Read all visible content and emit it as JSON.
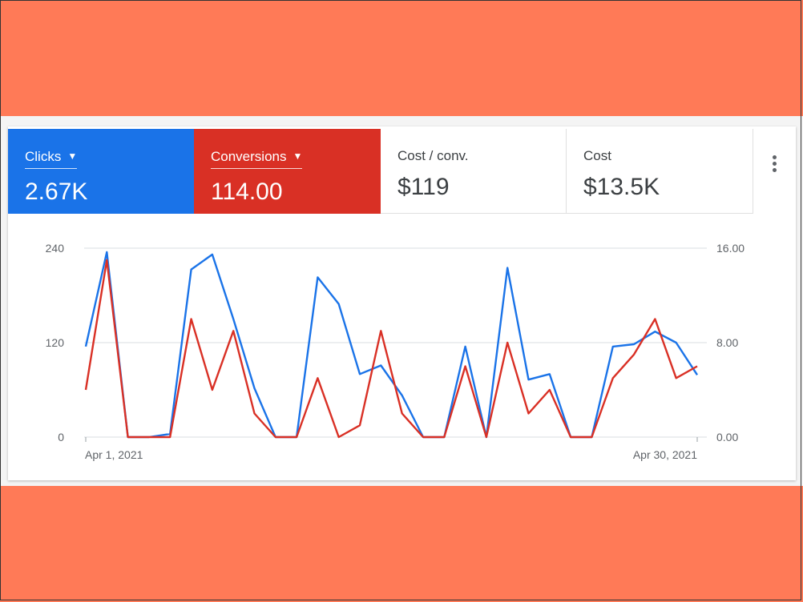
{
  "metrics": {
    "clicks": {
      "label": "Clicks",
      "value": "2.67K"
    },
    "conversions": {
      "label": "Conversions",
      "value": "114.00"
    },
    "cost_per_conv": {
      "label": "Cost / conv.",
      "value": "$119"
    },
    "cost": {
      "label": "Cost",
      "value": "$13.5K"
    }
  },
  "colors": {
    "clicks": "#1a73e8",
    "conversions": "#d93025",
    "background": "#ff7a57"
  },
  "icons": {
    "dropdown": "caret-down-icon",
    "more": "more-vert-icon"
  },
  "chart_data": {
    "type": "line",
    "x_start_label": "Apr 1, 2021",
    "x_end_label": "Apr 30, 2021",
    "x": [
      "Apr 1",
      "Apr 2",
      "Apr 3",
      "Apr 4",
      "Apr 5",
      "Apr 6",
      "Apr 7",
      "Apr 8",
      "Apr 9",
      "Apr 10",
      "Apr 11",
      "Apr 12",
      "Apr 13",
      "Apr 14",
      "Apr 15",
      "Apr 16",
      "Apr 17",
      "Apr 18",
      "Apr 19",
      "Apr 20",
      "Apr 21",
      "Apr 22",
      "Apr 23",
      "Apr 24",
      "Apr 25",
      "Apr 26",
      "Apr 27",
      "Apr 28",
      "Apr 29",
      "Apr 30"
    ],
    "left_axis": {
      "ticks": [
        "0",
        "120",
        "240"
      ],
      "ylim": [
        0,
        240
      ]
    },
    "right_axis": {
      "ticks": [
        "0.00",
        "8.00",
        "16.00"
      ],
      "ylim": [
        0,
        16
      ]
    },
    "grid": true,
    "series": [
      {
        "name": "Clicks",
        "axis": "left",
        "color": "#1a73e8",
        "values": [
          115,
          235,
          0,
          0,
          4,
          213,
          232,
          150,
          62,
          0,
          0,
          203,
          169,
          80,
          91,
          53,
          0,
          0,
          115,
          0,
          215,
          73,
          80,
          0,
          0,
          115,
          118,
          134,
          120,
          79
        ]
      },
      {
        "name": "Conversions",
        "axis": "right",
        "color": "#d93025",
        "values": [
          4,
          15,
          0,
          0,
          0,
          10,
          4,
          9,
          2,
          0,
          0,
          5,
          0,
          1,
          9,
          2,
          0,
          0,
          6,
          0,
          8,
          2,
          4,
          0,
          0,
          5,
          7,
          10,
          5,
          6
        ]
      }
    ]
  }
}
